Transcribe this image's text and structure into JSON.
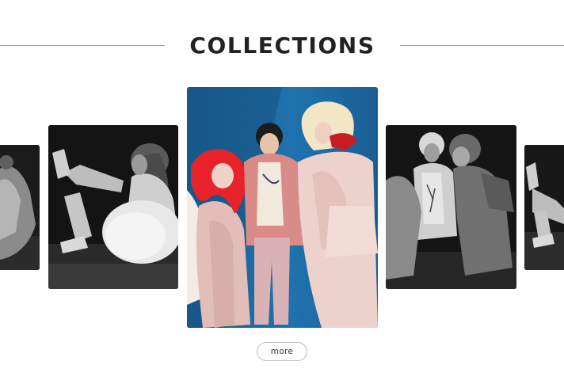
{
  "header": {
    "title": "COLLECTIONS"
  },
  "carousel": {
    "slides": [
      {
        "id": "far-left",
        "tone": "grayscale"
      },
      {
        "id": "near-left",
        "tone": "grayscale"
      },
      {
        "id": "center",
        "tone": "color",
        "active": true
      },
      {
        "id": "near-right",
        "tone": "grayscale"
      },
      {
        "id": "far-right",
        "tone": "grayscale"
      }
    ],
    "colors": {
      "center_background": "#1f6fa7",
      "accent_hair_red": "#e8222b",
      "coat_pink": "#e9c9c4",
      "blonde": "#f2e6c6"
    }
  },
  "actions": {
    "more_label": "more"
  }
}
